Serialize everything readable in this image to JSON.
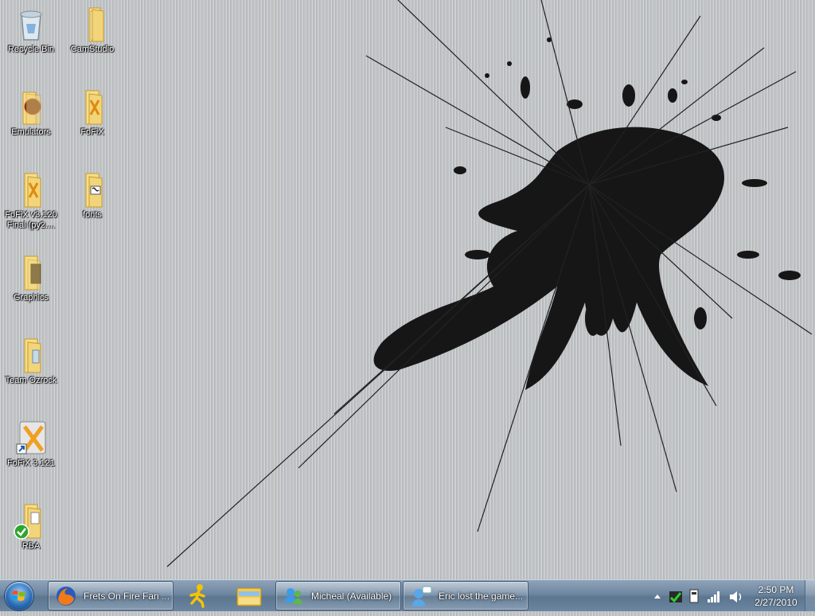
{
  "desktop": {
    "icons": [
      {
        "label": "Recycle Bin",
        "icon": "recycle-bin-icon"
      },
      {
        "label": "CamStudio",
        "icon": "folder-icon"
      },
      {
        "label": "Emulators",
        "icon": "folder-icon"
      },
      {
        "label": "FoFiX",
        "icon": "folder-icon"
      },
      {
        "label": "FoFiX v3.120 Final (py2....",
        "icon": "folder-icon"
      },
      {
        "label": "fonts",
        "icon": "folder-icon"
      },
      {
        "label": "Graphics",
        "icon": "folder-icon"
      },
      {
        "label": "Team Ozrock",
        "icon": "folder-icon"
      },
      {
        "label": "FoFiX 3.121",
        "icon": "shortcut-icon"
      },
      {
        "label": "RBA",
        "icon": "folder-icon"
      }
    ]
  },
  "taskbar": {
    "start": {
      "icon": "windows-start-icon"
    },
    "tasks": [
      {
        "label": "Frets On Fire Fan ...",
        "icon": "firefox-icon"
      },
      {
        "label": "Micheal (Available)",
        "icon": "messenger-icon"
      },
      {
        "label": "Eric lost the game...",
        "icon": "chat-icon"
      }
    ],
    "pinned": [
      {
        "icon": "aim-icon"
      },
      {
        "icon": "explorer-icon"
      }
    ],
    "tray": {
      "icons": [
        "show-hidden-icons-icon",
        "network-check-icon",
        "usb-device-icon",
        "signal-bars-icon",
        "volume-icon"
      ]
    },
    "clock": {
      "time": "2:50 PM",
      "date": "2/27/2010"
    }
  },
  "colors": {
    "folder": "#f2d57a",
    "taskbar": "#6d86a0",
    "crack": "#141414"
  }
}
